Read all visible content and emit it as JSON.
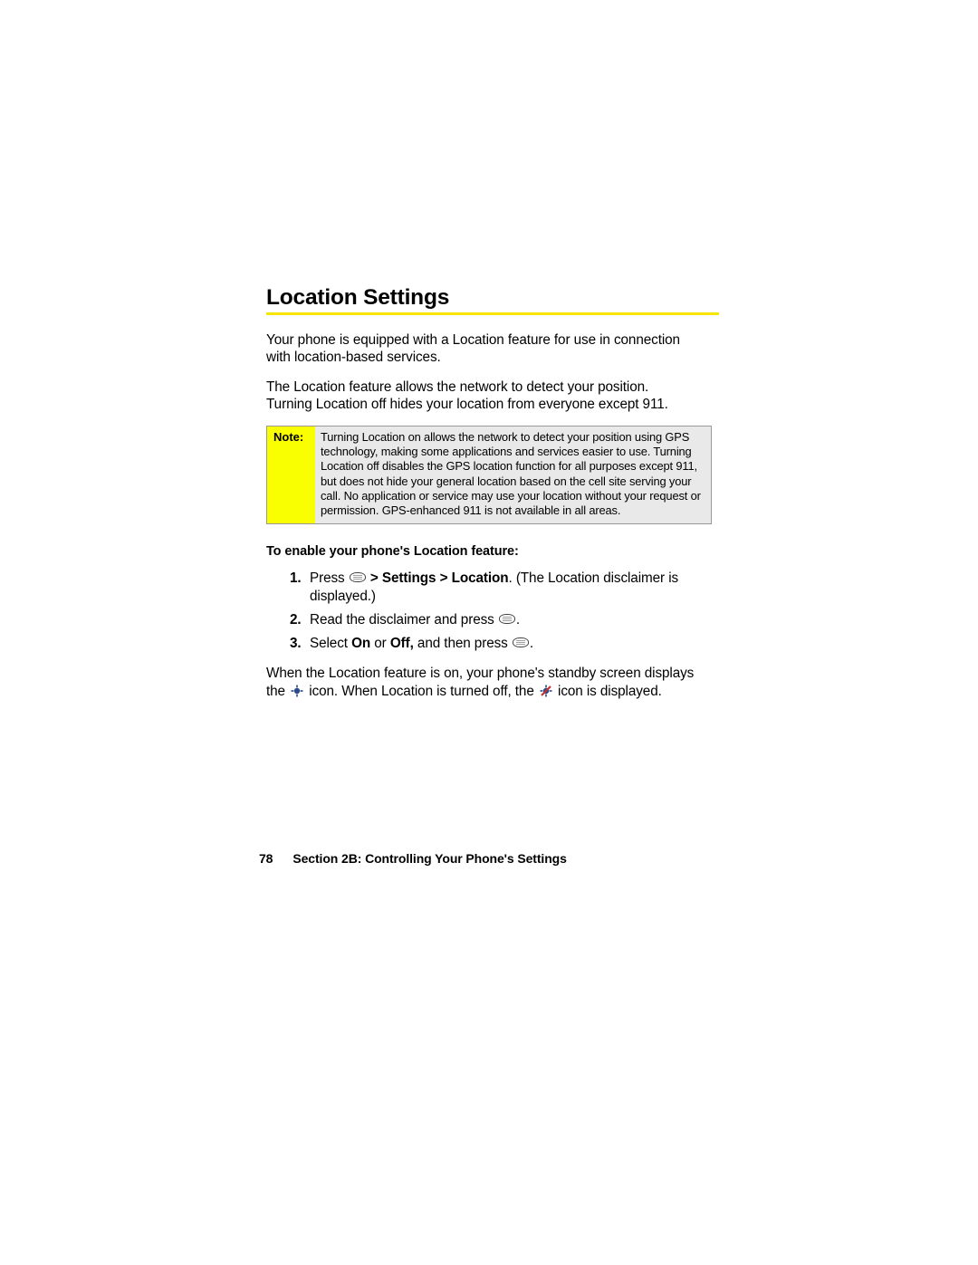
{
  "heading": "Location Settings",
  "para1": "Your phone is equipped with a Location feature for use in connection with location-based services.",
  "para2": "The Location feature allows the network to detect your position. Turning Location off hides your location from everyone except 911.",
  "note": {
    "label": "Note:",
    "text": "Turning Location on allows the network to detect your position using GPS technology, making some applications and services easier to use. Turning Location off disables the GPS location function for all purposes except 911, but does not hide your general location based on the cell site serving your call. No application or service may use your location without your request or permission. GPS-enhanced 911 is not available in all areas."
  },
  "subhead": "To enable your phone's Location feature:",
  "steps": [
    {
      "num": "1.",
      "t1": "Press ",
      "bold1": " > Settings > Location",
      "t2": ". (The Location disclaimer is displayed.)"
    },
    {
      "num": "2.",
      "t1": "Read the disclaimer and press ",
      "t2": "."
    },
    {
      "num": "3.",
      "t1": "Select ",
      "bold_on": "On",
      "mid": " or ",
      "bold_off": "Off,",
      "t2": " and then press ",
      "t3": "."
    }
  ],
  "closing": {
    "t1": "When the Location feature is on, your phone's standby screen displays the ",
    "t2": " icon. When Location is turned off, the ",
    "t3": " icon is displayed."
  },
  "footer": {
    "page": "78",
    "section": "Section 2B: Controlling Your Phone's Settings"
  }
}
